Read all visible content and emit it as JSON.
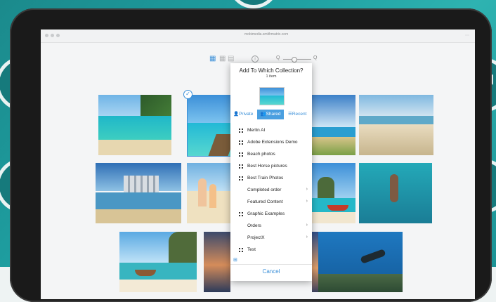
{
  "browser": {
    "url": "mobimedia.smithmatrix.com"
  },
  "toolbar": {
    "view_icons": [
      "grid-view-icon",
      "list-view-icon",
      "detail-view-icon"
    ],
    "zoom_out": "Q",
    "zoom_in": "Q"
  },
  "dialog": {
    "title": "Add To Which Collection?",
    "subtitle": "1 item",
    "tabs": [
      {
        "label": "Private",
        "icon": "person-icon",
        "active": false
      },
      {
        "label": "Shared",
        "icon": "group-icon",
        "active": true
      },
      {
        "label": "Recent",
        "icon": "list-icon",
        "active": false
      }
    ],
    "collections": [
      {
        "label": "Merlin AI",
        "kind": "collection"
      },
      {
        "label": "Adobe Extensions Demo",
        "kind": "collection"
      },
      {
        "label": "Beach photos",
        "kind": "collection"
      },
      {
        "label": "Best Horse pictures",
        "kind": "collection"
      },
      {
        "label": "Best Train Photos",
        "kind": "collection"
      },
      {
        "label": "Completed order",
        "kind": "folder"
      },
      {
        "label": "Featured Content",
        "kind": "folder"
      },
      {
        "label": "Graphic Examples",
        "kind": "collection"
      },
      {
        "label": "Orders",
        "kind": "folder"
      },
      {
        "label": "ProjectX",
        "kind": "folder"
      },
      {
        "label": "Test",
        "kind": "collection"
      }
    ],
    "cancel_label": "Cancel"
  },
  "colors": {
    "accent": "#3a8fd8",
    "teal": "#1e9ea0"
  }
}
